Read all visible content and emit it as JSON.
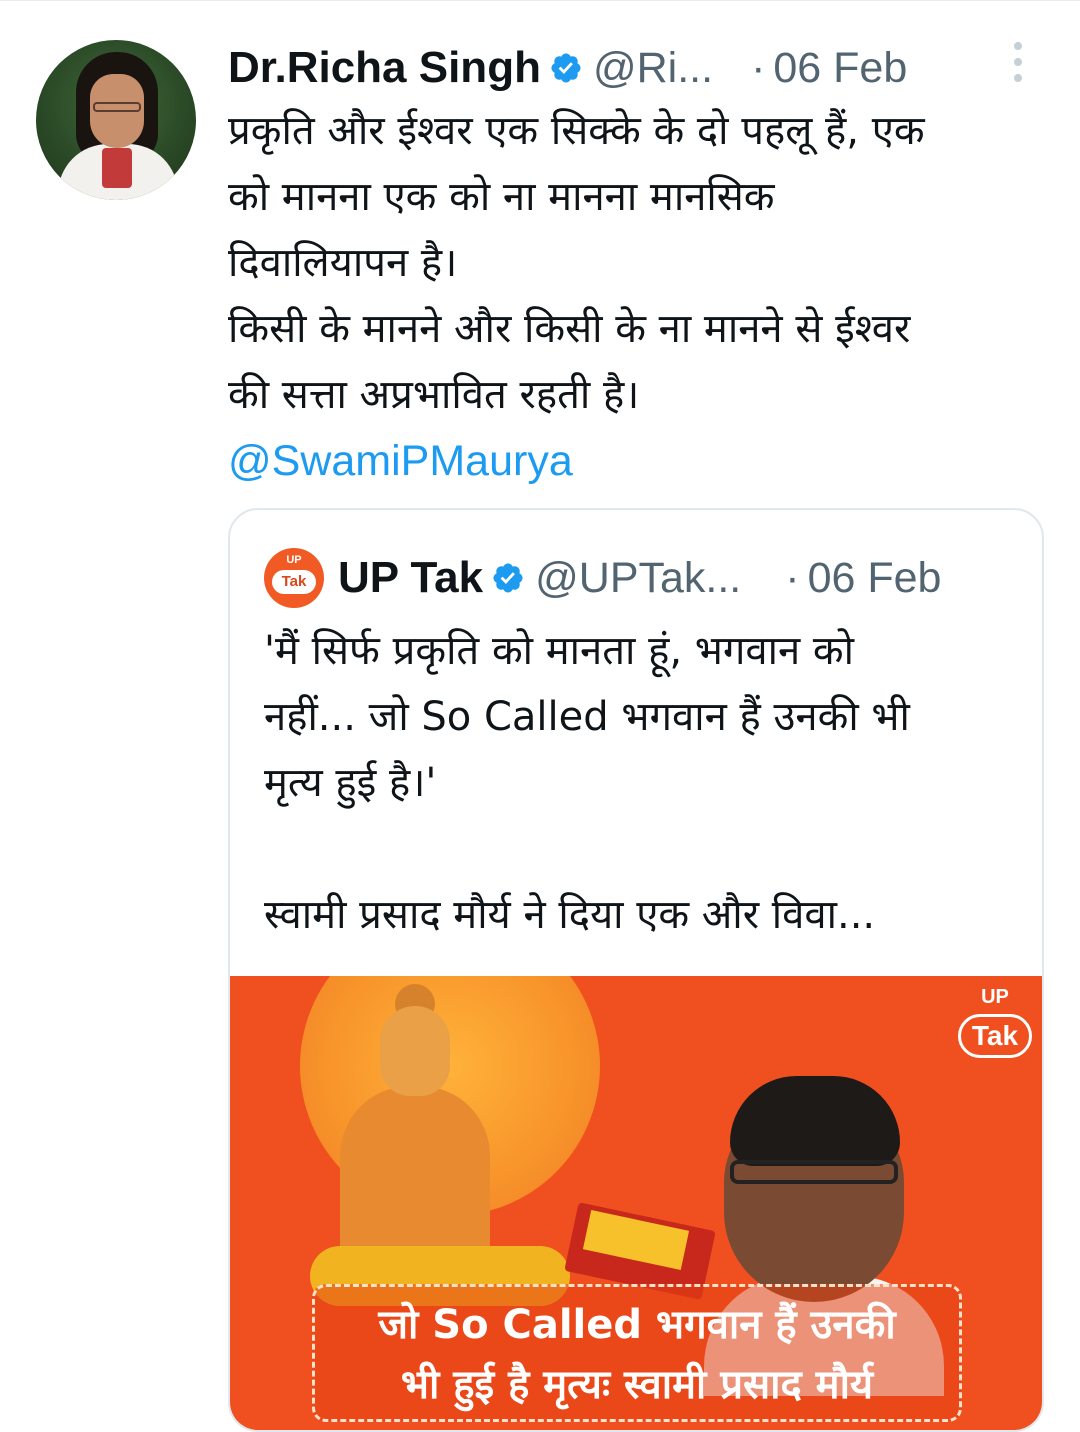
{
  "tweet": {
    "author_name": "Dr.Richa Singh",
    "handle": "@Ri...",
    "dot": "·",
    "date": "06 Feb",
    "text": "प्रकृति और ईश्वर एक सिक्के के दो पहलू हैं, एक\nको मानना एक को ना मानना मानसिक\nदिवालियापन है।\nकिसी के मानने और किसी के ना मानने से ईश्वर\nकी सत्ता अप्रभावित रहती है।",
    "mention": "@SwamiPMaurya"
  },
  "quoted_tweet": {
    "logo_up": "UP",
    "logo_tak": "Tak",
    "author_name": "UP Tak",
    "handle": "@UPTak...",
    "dot": "·",
    "date": "06 Feb",
    "text": "'मैं सिर्फ प्रकृति को मानता हूं, भगवान को\nनहीं... जो So Called भगवान हैं उनकी भी\nमृत्य हुई है।'\n\nस्वामी प्रसाद मौर्य ने दिया एक और विवा...",
    "image": {
      "logo_up": "UP",
      "logo_tak": "Tak",
      "caption": "जो So Called भगवान हैं उनकी\nभी हुई है मृत्यः स्वामी प्रसाद मौर्य"
    }
  },
  "colors": {
    "verified_blue": "#1d9bf0",
    "text_primary": "#0f1419",
    "text_secondary": "#536471",
    "link": "#1d9bf0",
    "image_background": "#f0501f"
  },
  "icons": {
    "verified": "verified-badge-icon",
    "more": "more-vertical-icon"
  }
}
